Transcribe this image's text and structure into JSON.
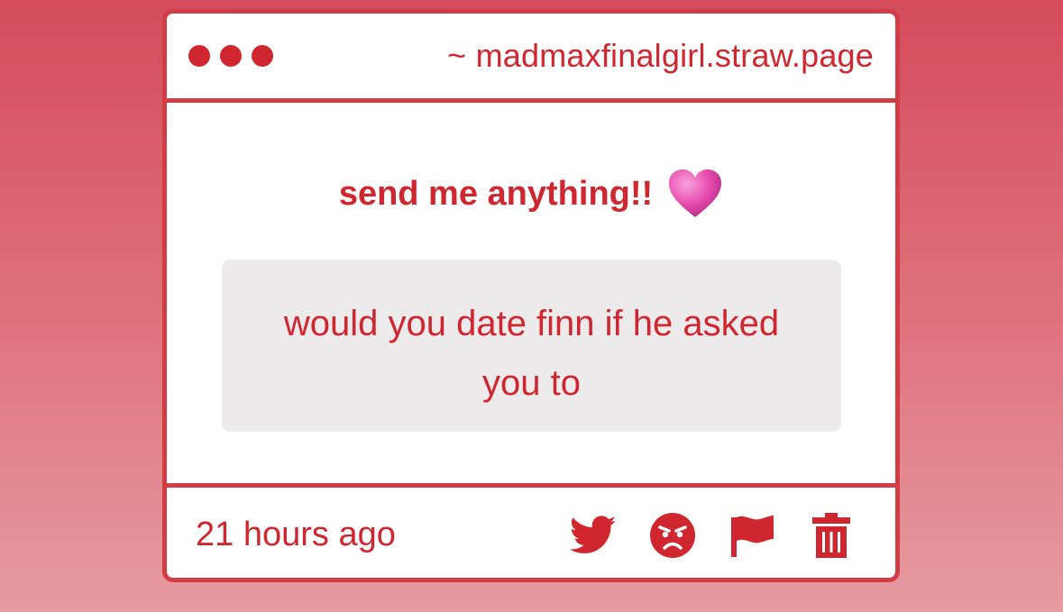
{
  "window": {
    "url": "~ madmaxfinalgirl.straw.page"
  },
  "prompt": {
    "text": "send me anything!!",
    "emoji_icon": "pink-heart-icon"
  },
  "message": {
    "text": "would you date finn if he asked you to"
  },
  "footer": {
    "timestamp": "21 hours ago",
    "actions": [
      {
        "icon": "twitter-bird-icon"
      },
      {
        "icon": "angry-face-icon"
      },
      {
        "icon": "flag-icon"
      },
      {
        "icon": "trash-icon"
      }
    ]
  },
  "colors": {
    "accent": "#d0262f",
    "border": "#d23c45",
    "message_bg": "#eceaeb",
    "heart": "#e94fb0"
  }
}
